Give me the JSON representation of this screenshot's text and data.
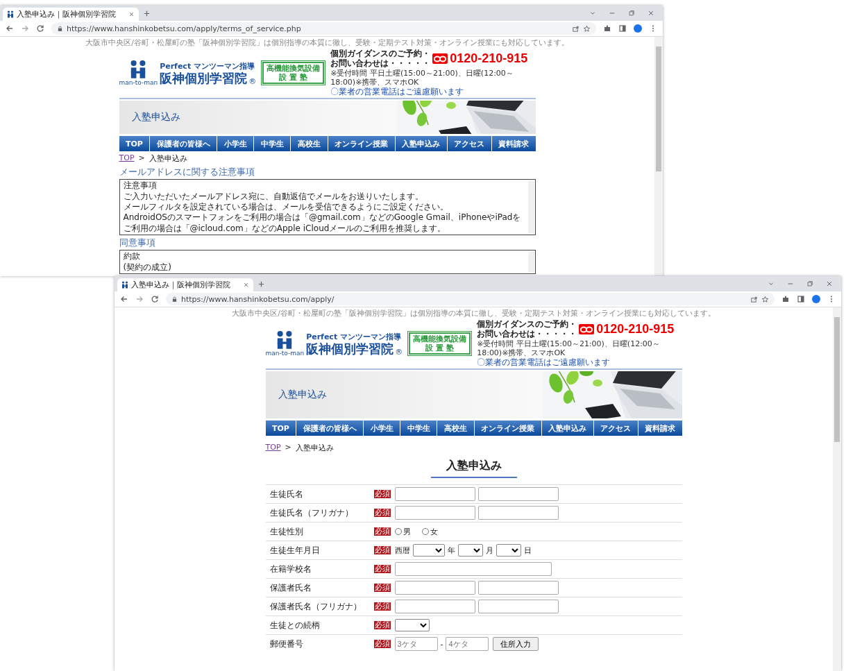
{
  "windows": [
    {
      "tab_title": "入塾申込み｜阪神個別学習院",
      "url": "https://www.hanshinkobetsu.com/apply/terms_of_service.php",
      "header": {
        "tagline": "大阪市中央区/谷町・松屋町の塾「阪神個別学習院」は個別指導の本質に徹し、受験・定期テスト対策・オンライン授業にも対応しています。",
        "logo_caption": "man-to-man",
        "logo_sub": "Perfect マンツーマン指導",
        "logo_name": "阪神個別学習院",
        "logo_mark": "®",
        "badge_lines": [
          "高機能換気設備",
          "設 置 塾"
        ],
        "contact_lines": [
          "個別ガイダンスのご予約・",
          "お問い合わせは・・・・・"
        ],
        "phone": "0120-210-915",
        "hours": "※受付時間 平日土曜(15:00～21:00)、日曜(12:00～18:00)※携帯、スマホOK",
        "notice": "〇業者の営業電話はご遠慮願います",
        "banner_title": "入塾申込み"
      },
      "nav": [
        "TOP",
        "保護者の皆様へ",
        "小学生",
        "中学生",
        "高校生",
        "オンライン授業",
        "入塾申込み",
        "アクセス",
        "資料請求"
      ],
      "breadcrumb": {
        "home": "TOP",
        "separator": ">",
        "current": "入塾申込み"
      },
      "sections": [
        {
          "heading": "メールアドレスに関する注意事項",
          "lines": [
            "注意事項",
            "ご入力いただいたメールアドレス宛に、自動返信でメールをお送りいたします。",
            "メールフィルタを設定されている場合は、メールを受信できるようにご設定ください。",
            "AndroidOSのスマートフォンをご利用の場合は「@gmail.com」などのGoogle Gmail、iPhoneやiPadをご利用の場合は「@icloud.com」などのApple iCloudメールのご利用を推奨します。"
          ]
        },
        {
          "heading": "同意事項",
          "lines": [
            "約款",
            "(契約の成立)"
          ]
        }
      ]
    },
    {
      "tab_title": "入塾申込み｜阪神個別学習院",
      "url": "https://www.hanshinkobetsu.com/apply/",
      "header": {
        "tagline": "大阪市中央区/谷町・松屋町の塾「阪神個別学習院」は個別指導の本質に徹し、受験・定期テスト対策・オンライン授業にも対応しています。",
        "logo_caption": "man-to-man",
        "logo_sub": "Perfect マンツーマン指導",
        "logo_name": "阪神個別学習院",
        "logo_mark": "®",
        "badge_lines": [
          "高機能換気設備",
          "設 置 塾"
        ],
        "contact_lines": [
          "個別ガイダンスのご予約・",
          "お問い合わせは・・・・・"
        ],
        "phone": "0120-210-915",
        "hours": "※受付時間 平日土曜(15:00～21:00)、日曜(12:00～18:00)※携帯、スマホOK",
        "notice": "〇業者の営業電話はご遠慮願います",
        "banner_title": "入塾申込み"
      },
      "nav": [
        "TOP",
        "保護者の皆様へ",
        "小学生",
        "中学生",
        "高校生",
        "オンライン授業",
        "入塾申込み",
        "アクセス",
        "資料請求"
      ],
      "breadcrumb": {
        "home": "TOP",
        "separator": ">",
        "current": "入塾申込み"
      },
      "form": {
        "title": "入塾申込み",
        "rows": [
          {
            "label": "生徒氏名",
            "required": "必須",
            "kind": "name_pair"
          },
          {
            "label": "生徒氏名（フリガナ）",
            "required": "必須",
            "kind": "name_pair"
          },
          {
            "label": "生徒性別",
            "required": "必須",
            "kind": "radio",
            "options": [
              {
                "label": "男",
                "selected": false
              },
              {
                "label": "女",
                "selected": false
              }
            ]
          },
          {
            "label": "生徒生年月日",
            "required": "必須",
            "kind": "date",
            "era": "西暦",
            "units": [
              "年",
              "月",
              "日"
            ]
          },
          {
            "label": "在籍学校名",
            "required": "必須",
            "kind": "text"
          },
          {
            "label": "保護者氏名",
            "required": "必須",
            "kind": "name_pair"
          },
          {
            "label": "保護者氏名（フリガナ）",
            "required": "必須",
            "kind": "name_pair"
          },
          {
            "label": "生徒との続柄",
            "required": "必須",
            "kind": "select"
          },
          {
            "label": "郵便番号",
            "required": "必須",
            "kind": "postal",
            "placeholders": [
              "3ケタ",
              "4ケタ"
            ],
            "separator": "-",
            "button": "住所入力"
          }
        ]
      }
    }
  ]
}
